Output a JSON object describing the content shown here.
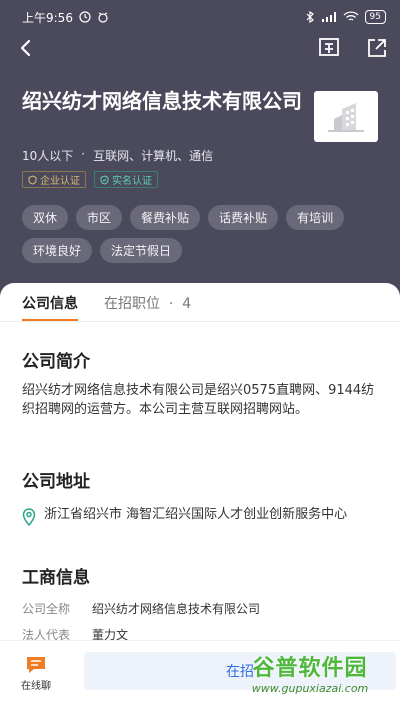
{
  "status_bar": {
    "time": "上午9:56",
    "battery": "95"
  },
  "company": {
    "name": "绍兴纺才网络信息技术有限公司",
    "size": "10人以下",
    "industry": "互联网、计算机、通信",
    "badges": [
      "企业认证",
      "实名认证"
    ],
    "tags": [
      "双休",
      "市区",
      "餐费补贴",
      "话费补贴",
      "有培训",
      "环境良好",
      "法定节假日"
    ]
  },
  "tabs": {
    "info": "公司信息",
    "jobs": "在招职位",
    "jobs_count": "4"
  },
  "intro": {
    "title": "公司简介",
    "text": "绍兴纺才网络信息技术有限公司是绍兴0575直聘网、9144纺织招聘网的运营方。本公司主营互联网招聘网站。"
  },
  "address": {
    "title": "公司地址",
    "text": "浙江省绍兴市 海智汇绍兴国际人才创业创新服务中心"
  },
  "business": {
    "title": "工商信息",
    "rows": [
      {
        "label": "公司全称",
        "value": "绍兴纺才网络信息技术有限公司"
      },
      {
        "label": "法人代表",
        "value": "董力文"
      }
    ]
  },
  "bottom": {
    "chat_label": "在线聊",
    "jobs_button": "在招"
  },
  "watermark": {
    "main": "谷普软件园",
    "sub": "www.gupuxiazai.com"
  },
  "colors": {
    "hero": "#4b4a5c",
    "accent": "#ef7b23",
    "link": "#2f6ee0"
  }
}
